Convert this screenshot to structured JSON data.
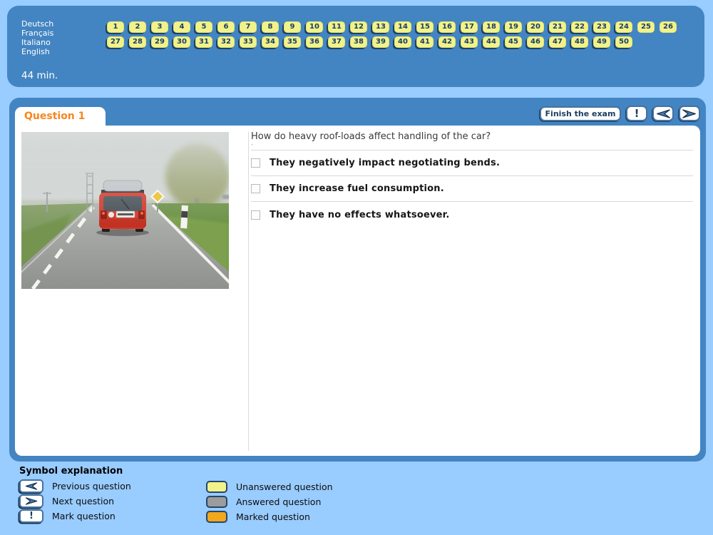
{
  "topbar": {
    "languages": [
      "Deutsch",
      "Français",
      "Italiano",
      "English"
    ],
    "timer": "44 min.",
    "question_nav": {
      "row1": [
        1,
        2,
        3,
        4,
        5,
        6,
        7,
        8,
        9,
        10,
        11,
        12,
        13,
        14,
        15,
        16,
        17,
        18,
        19,
        20,
        21,
        22,
        23,
        24,
        25,
        26
      ],
      "row2": [
        27,
        28,
        29,
        30,
        31,
        32,
        33,
        34,
        35,
        36,
        37,
        38,
        39,
        40,
        41,
        42,
        43,
        44,
        45,
        46,
        47,
        48,
        49,
        50
      ],
      "no_shadow": [
        25,
        26
      ]
    }
  },
  "panel": {
    "tab_title": "Question 1",
    "finish_label": "Finish the exam",
    "mark_symbol": "!",
    "question_text": "How do heavy roof-loads affect handling of the car?",
    "question_note": "-",
    "answers": [
      "They negatively impact negotiating bends.",
      "They increase fuel consumption.",
      "They have no effects whatsoever."
    ]
  },
  "legend": {
    "title": "Symbol explanation",
    "left": [
      {
        "icon": "previous-arrow-icon",
        "label": "Previous question"
      },
      {
        "icon": "next-arrow-icon",
        "label": "Next question"
      },
      {
        "icon": "exclamation-icon",
        "label": "Mark question"
      }
    ],
    "right": [
      {
        "color": "#F2F28B",
        "label": "Unanswered question"
      },
      {
        "color": "#9C9C9C",
        "label": "Answered question"
      },
      {
        "color": "#F2A71D",
        "label": "Marked question"
      }
    ]
  },
  "colors": {
    "page_bg": "#99CCFF",
    "panel_blue": "#4385C2",
    "accent_navy": "#1C3E63",
    "button_yellow": "#F2F28B",
    "tab_orange": "#F6861F"
  }
}
